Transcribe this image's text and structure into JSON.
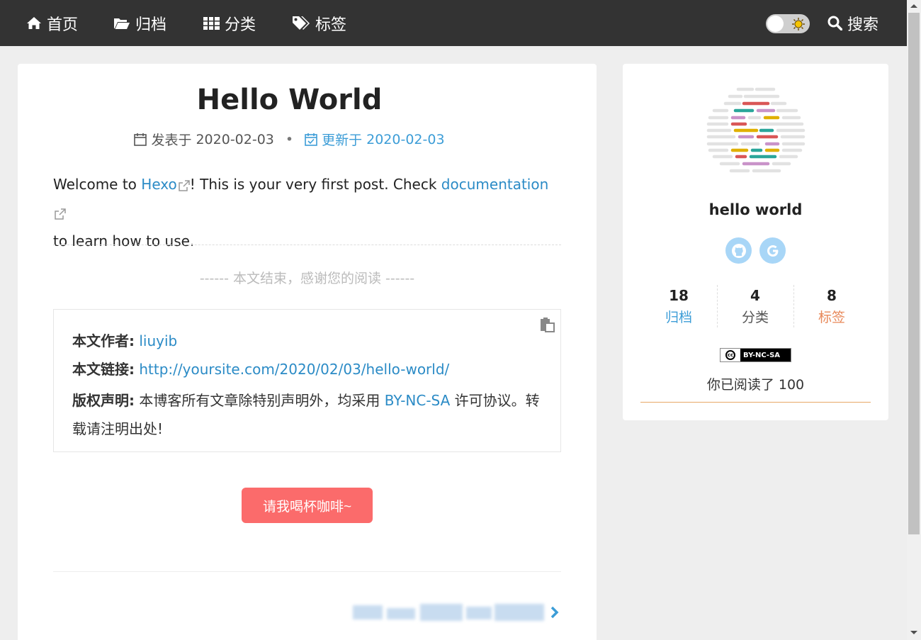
{
  "nav": {
    "items": [
      {
        "label": "首页",
        "icon": "home-icon"
      },
      {
        "label": "归档",
        "icon": "folder-open-icon"
      },
      {
        "label": "分类",
        "icon": "grid-icon"
      },
      {
        "label": "标签",
        "icon": "tags-icon"
      }
    ],
    "search_label": "搜索"
  },
  "post": {
    "title": "Hello World",
    "published_label": "发表于",
    "published_date": "2020-02-03",
    "updated_label": "更新于",
    "updated_date": "2020-02-03",
    "body": {
      "part1": "Welcome to ",
      "link1": "Hexo",
      "part2": "! This is your very first post. Check ",
      "link2": "documentation",
      "part3": "to learn how to use."
    },
    "end_text": "------ 本文结束，感谢您的阅读 ------",
    "copyright": {
      "author_label": "本文作者:",
      "author": "liuyib",
      "link_label": "本文链接:",
      "link": "http://yoursite.com/2020/02/03/hello-world/",
      "license_label": "版权声明:",
      "license_before": "本博客所有文章除特别声明外，均采用",
      "license_link": "BY-NC-SA",
      "license_after": "许可协议。转",
      "license_line2": "载请注明出处!"
    },
    "donate_label": "请我喝杯咖啡~"
  },
  "sidebar": {
    "site_name": "hello world",
    "stats": [
      {
        "count": "18",
        "label": "归档",
        "color": "#3c9dd7"
      },
      {
        "count": "4",
        "label": "分类",
        "color": "#555555"
      },
      {
        "count": "8",
        "label": "标签",
        "color": "#e8895a"
      }
    ],
    "license_badge": "BY-NC-SA",
    "cc_mark": "cc",
    "read_count": "你已阅读了 100"
  },
  "colors": {
    "navbar": "#333333",
    "link": "#2b8bc6",
    "donate": "#fb6b6b",
    "social": "#a8d6f7"
  }
}
